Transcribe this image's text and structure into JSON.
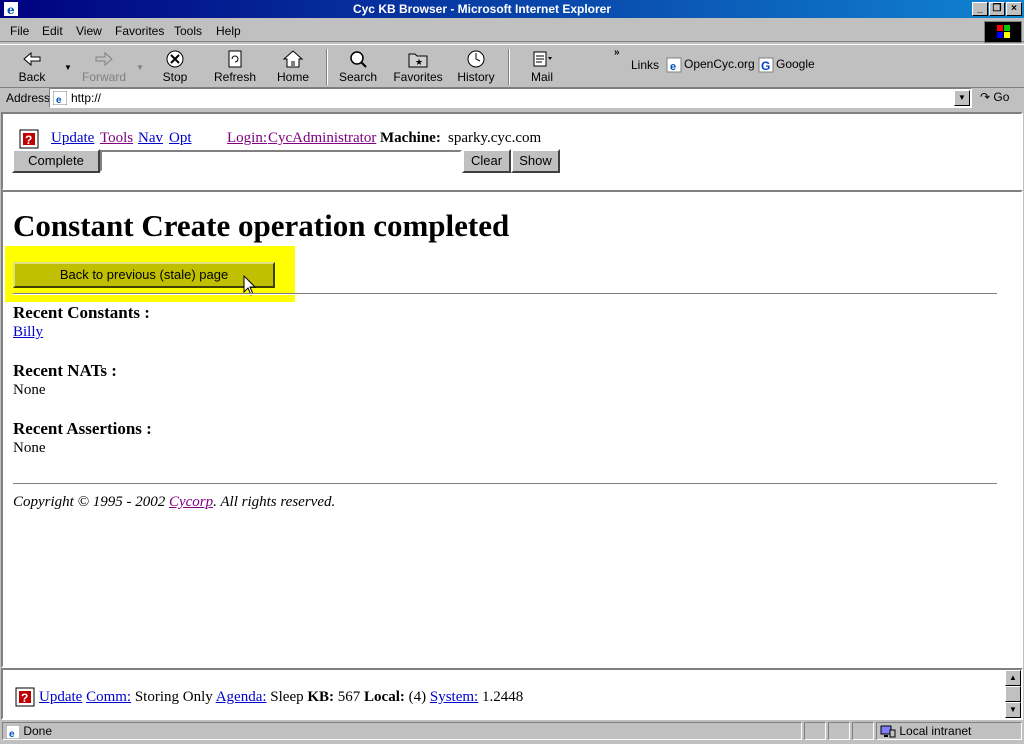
{
  "window": {
    "title": "Cyc KB Browser - Microsoft Internet Explorer"
  },
  "menu": [
    "File",
    "Edit",
    "View",
    "Favorites",
    "Tools",
    "Help"
  ],
  "toolbar": {
    "back": "Back",
    "forward": "Forward",
    "stop": "Stop",
    "refresh": "Refresh",
    "home": "Home",
    "search": "Search",
    "favorites": "Favorites",
    "history": "History",
    "mail": "Mail"
  },
  "links": {
    "label": "Links",
    "opencyc": "OpenCyc.org",
    "google": "Google"
  },
  "address": {
    "label": "Address",
    "value": "http://",
    "go": "Go"
  },
  "top_frame": {
    "update": "Update",
    "tools": "Tools",
    "nav": "Nav",
    "opt": "Opt",
    "login_label": "Login:",
    "login_user": "CycAdministrator",
    "machine_label": "Machine:",
    "machine_value": "sparky.cyc.com",
    "complete_btn": "Complete",
    "clear_btn": "Clear",
    "show_btn": "Show",
    "input_value": ""
  },
  "main": {
    "heading": "Constant Create operation completed",
    "back_button": "Back to previous (stale) page",
    "recent_constants_title": "Recent Constants :",
    "recent_constants": [
      "Billy"
    ],
    "recent_nats_title": "Recent NATs :",
    "recent_nats_value": "None",
    "recent_assertions_title": "Recent Assertions :",
    "recent_assertions_value": "None",
    "copyright_prefix": "Copyright © 1995 - 2002",
    "copyright_link": "Cycorp",
    "copyright_suffix": ". All rights reserved."
  },
  "bottom_frame": {
    "update": "Update",
    "comm": "Comm:",
    "comm_value": "Storing Only",
    "agenda": "Agenda:",
    "agenda_value": "Sleep",
    "kb_label": "KB:",
    "kb_value": "567",
    "local_label": "Local:",
    "local_value": "(4)",
    "system": "System:",
    "system_value": "1.2448"
  },
  "status": {
    "text": "Done",
    "zone": "Local intranet"
  },
  "colors": {
    "titlebar": "#000080",
    "highlight": "#ffff00",
    "back_button": "#c0c000",
    "link": "#0000cc",
    "visited": "#800080"
  }
}
